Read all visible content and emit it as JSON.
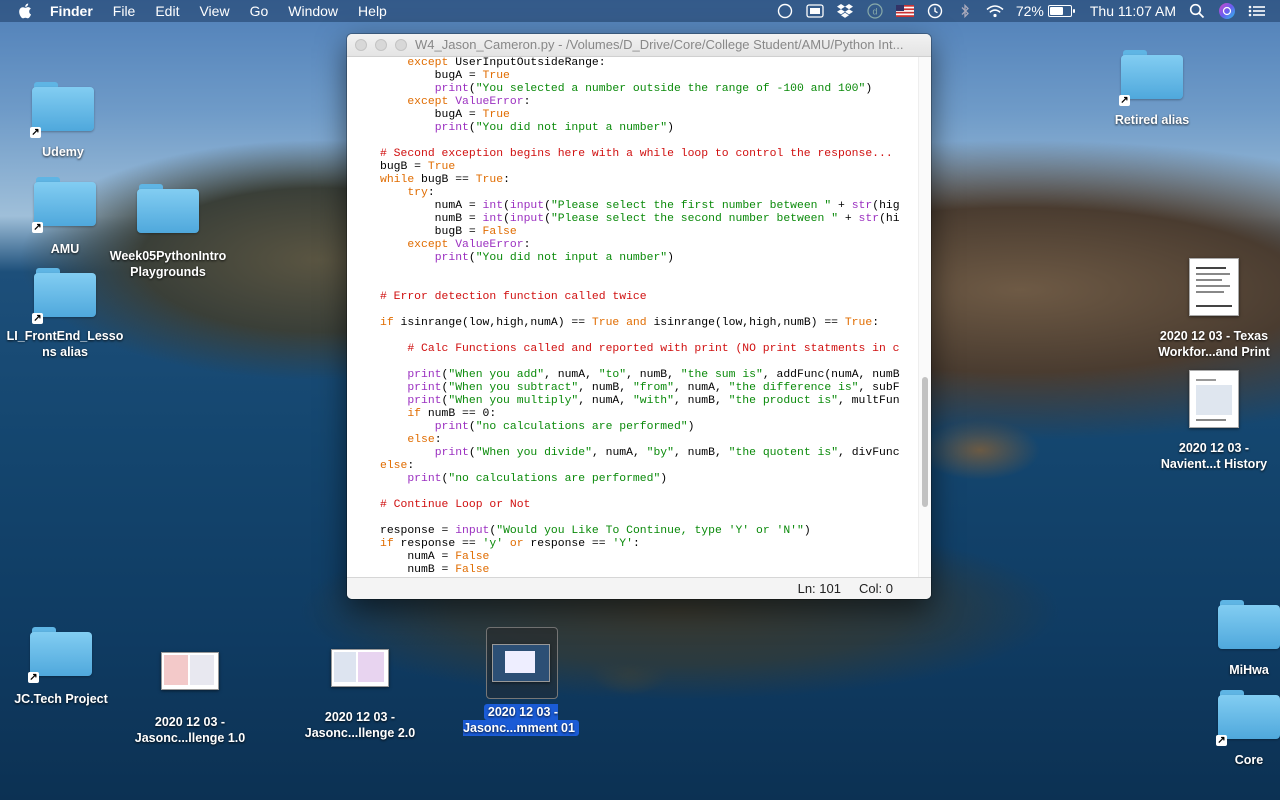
{
  "menubar": {
    "app": "Finder",
    "items": [
      "File",
      "Edit",
      "View",
      "Go",
      "Window",
      "Help"
    ],
    "battery": "72%",
    "battery_level": 0.72,
    "clock": "Thu 11:07 AM",
    "status_icons": [
      "screen-mirroring-icon",
      "display-icon",
      "dropbox-icon",
      "accessibility-icon",
      "us-flag-icon",
      "time-machine-icon",
      "bluetooth-icon",
      "wifi-icon"
    ]
  },
  "window": {
    "title": "W4_Jason_Cameron.py - /Volumes/D_Drive/Core/College Student/AMU/Python Int...",
    "status": {
      "line": "Ln: 101",
      "col": "Col: 0"
    }
  },
  "code_lines": [
    [
      [
        "    ",
        ""
      ],
      [
        "except",
        "k"
      ],
      [
        " UserInputOutsideRange:",
        ""
      ]
    ],
    [
      [
        "        bugA = ",
        ""
      ],
      [
        "True",
        "k"
      ]
    ],
    [
      [
        "        ",
        ""
      ],
      [
        "print",
        "b"
      ],
      [
        "(",
        ""
      ],
      [
        "\"You selected a number outside the range of -100 and 100\"",
        "s"
      ],
      [
        ")",
        ""
      ]
    ],
    [
      [
        "    ",
        ""
      ],
      [
        "except",
        "k"
      ],
      [
        " ",
        ""
      ],
      [
        "ValueError",
        "b"
      ],
      [
        ":",
        ""
      ]
    ],
    [
      [
        "        bugA = ",
        ""
      ],
      [
        "True",
        "k"
      ]
    ],
    [
      [
        "        ",
        ""
      ],
      [
        "print",
        "b"
      ],
      [
        "(",
        ""
      ],
      [
        "\"You did not input a number\"",
        "s"
      ],
      [
        ")",
        ""
      ]
    ],
    [],
    [
      [
        "# Second exception begins here with a while loop to control the response...",
        "c"
      ]
    ],
    [
      [
        "bugB = ",
        ""
      ],
      [
        "True",
        "k"
      ]
    ],
    [
      [
        "while",
        "k"
      ],
      [
        " bugB == ",
        ""
      ],
      [
        "True",
        "k"
      ],
      [
        ":",
        ""
      ]
    ],
    [
      [
        "    ",
        ""
      ],
      [
        "try",
        "k"
      ],
      [
        ":",
        ""
      ]
    ],
    [
      [
        "        numA = ",
        ""
      ],
      [
        "int",
        "b"
      ],
      [
        "(",
        ""
      ],
      [
        "input",
        "b"
      ],
      [
        "(",
        ""
      ],
      [
        "\"Please select the first number between \"",
        "s"
      ],
      [
        " + ",
        ""
      ],
      [
        "str",
        "b"
      ],
      [
        "(hig",
        ""
      ]
    ],
    [
      [
        "        numB = ",
        ""
      ],
      [
        "int",
        "b"
      ],
      [
        "(",
        ""
      ],
      [
        "input",
        "b"
      ],
      [
        "(",
        ""
      ],
      [
        "\"Please select the second number between \"",
        "s"
      ],
      [
        " + ",
        ""
      ],
      [
        "str",
        "b"
      ],
      [
        "(hi",
        ""
      ]
    ],
    [
      [
        "        bugB = ",
        ""
      ],
      [
        "False",
        "k"
      ]
    ],
    [
      [
        "    ",
        ""
      ],
      [
        "except",
        "k"
      ],
      [
        " ",
        ""
      ],
      [
        "ValueError",
        "b"
      ],
      [
        ":",
        ""
      ]
    ],
    [
      [
        "        ",
        ""
      ],
      [
        "print",
        "b"
      ],
      [
        "(",
        ""
      ],
      [
        "\"You did not input a number\"",
        "s"
      ],
      [
        ")",
        ""
      ]
    ],
    [],
    [],
    [
      [
        "# Error detection function called twice",
        "c"
      ]
    ],
    [],
    [
      [
        "if",
        "k"
      ],
      [
        " isinrange(low,high,numA) == ",
        ""
      ],
      [
        "True",
        "k"
      ],
      [
        " ",
        ""
      ],
      [
        "and",
        "k"
      ],
      [
        " isinrange(low,high,numB) == ",
        ""
      ],
      [
        "True",
        "k"
      ],
      [
        ":",
        ""
      ]
    ],
    [],
    [
      [
        "    ",
        ""
      ],
      [
        "# Calc Functions called and reported with print (NO print statments in c",
        "c"
      ]
    ],
    [],
    [
      [
        "    ",
        ""
      ],
      [
        "print",
        "b"
      ],
      [
        "(",
        ""
      ],
      [
        "\"When you add\"",
        "s"
      ],
      [
        ", numA, ",
        ""
      ],
      [
        "\"to\"",
        "s"
      ],
      [
        ", numB, ",
        ""
      ],
      [
        "\"the sum is\"",
        "s"
      ],
      [
        ", addFunc(numA, numB",
        ""
      ]
    ],
    [
      [
        "    ",
        ""
      ],
      [
        "print",
        "b"
      ],
      [
        "(",
        ""
      ],
      [
        "\"When you subtract\"",
        "s"
      ],
      [
        ", numB, ",
        ""
      ],
      [
        "\"from\"",
        "s"
      ],
      [
        ", numA, ",
        ""
      ],
      [
        "\"the difference is\"",
        "s"
      ],
      [
        ", subF",
        ""
      ]
    ],
    [
      [
        "    ",
        ""
      ],
      [
        "print",
        "b"
      ],
      [
        "(",
        ""
      ],
      [
        "\"When you multiply\"",
        "s"
      ],
      [
        ", numA, ",
        ""
      ],
      [
        "\"with\"",
        "s"
      ],
      [
        ", numB, ",
        ""
      ],
      [
        "\"the product is\"",
        "s"
      ],
      [
        ", multFun",
        ""
      ]
    ],
    [
      [
        "    ",
        ""
      ],
      [
        "if",
        "k"
      ],
      [
        " numB == 0:",
        ""
      ]
    ],
    [
      [
        "        ",
        ""
      ],
      [
        "print",
        "b"
      ],
      [
        "(",
        ""
      ],
      [
        "\"no calculations are performed\"",
        "s"
      ],
      [
        ")",
        ""
      ]
    ],
    [
      [
        "    ",
        ""
      ],
      [
        "else",
        "k"
      ],
      [
        ":",
        ""
      ]
    ],
    [
      [
        "        ",
        ""
      ],
      [
        "print",
        "b"
      ],
      [
        "(",
        ""
      ],
      [
        "\"When you divide\"",
        "s"
      ],
      [
        ", numA, ",
        ""
      ],
      [
        "\"by\"",
        "s"
      ],
      [
        ", numB, ",
        ""
      ],
      [
        "\"the quotent is\"",
        "s"
      ],
      [
        ", divFunc",
        ""
      ]
    ],
    [
      [
        "else",
        "k"
      ],
      [
        ":",
        ""
      ]
    ],
    [
      [
        "    ",
        ""
      ],
      [
        "print",
        "b"
      ],
      [
        "(",
        ""
      ],
      [
        "\"no calculations are performed\"",
        "s"
      ],
      [
        ")",
        ""
      ]
    ],
    [],
    [
      [
        "# Continue Loop or Not",
        "c"
      ]
    ],
    [],
    [
      [
        "response = ",
        ""
      ],
      [
        "input",
        "b"
      ],
      [
        "(",
        ""
      ],
      [
        "\"Would you Like To Continue, type 'Y' or 'N'\"",
        "s"
      ],
      [
        ")",
        ""
      ]
    ],
    [
      [
        "if",
        "k"
      ],
      [
        " response == ",
        ""
      ],
      [
        "'y'",
        "s"
      ],
      [
        " ",
        ""
      ],
      [
        "or",
        "k"
      ],
      [
        " response == ",
        ""
      ],
      [
        "'Y'",
        "s"
      ],
      [
        ":",
        ""
      ]
    ],
    [
      [
        "    numA = ",
        ""
      ],
      [
        "False",
        "k"
      ]
    ],
    [
      [
        "    numB = ",
        ""
      ],
      [
        "False",
        "k"
      ]
    ]
  ],
  "desktop": {
    "udemy": "Udemy",
    "amu": "AMU",
    "week05": "Week05PythonIntroPlaygrounds",
    "li_frontend": "LI_FrontEnd_Lessons alias",
    "jctech": "JC.Tech Project",
    "challenge1": "2020 12 03 - Jasonc...llenge 1.0",
    "challenge2": "2020 12 03 - Jasonc...llenge 2.0",
    "comment01": "2020 12 03 - Jasonc...mment 01",
    "retired": "Retired alias",
    "texas": "2020 12 03 - Texas Workfor...and Print",
    "navient": "2020 12 03 - Navient...t History",
    "mihwa": "MiHwa",
    "core": "Core"
  }
}
